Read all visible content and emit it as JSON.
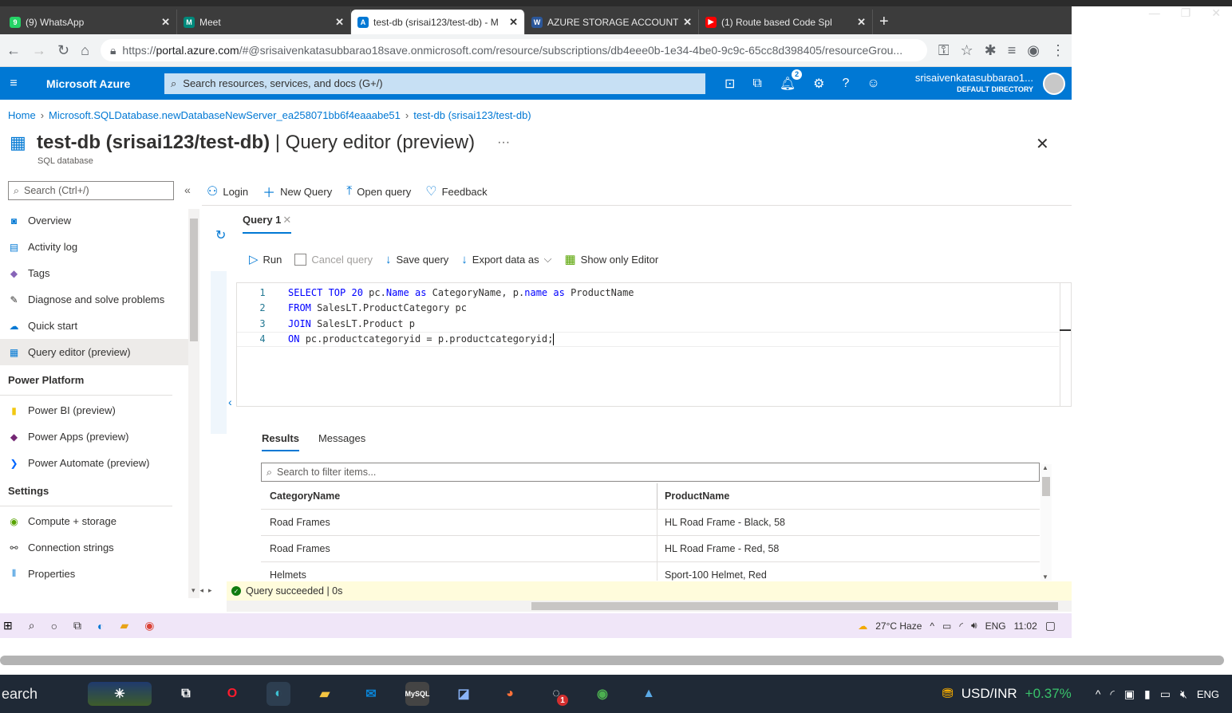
{
  "browser": {
    "tabs": [
      {
        "title": "(9) WhatsApp",
        "color": "#25d366",
        "glyph": "9"
      },
      {
        "title": "Meet",
        "color": "#00897b",
        "glyph": "M"
      },
      {
        "title": "test-db (srisai123/test-db) - M",
        "color": "#0078d4",
        "glyph": "A",
        "active": true
      },
      {
        "title": "AZURE STORAGE ACCOUNTS",
        "color": "#2b579a",
        "glyph": "W"
      },
      {
        "title": "(1) Route based Code Spl",
        "color": "#ff0000",
        "glyph": "▶"
      }
    ],
    "url_prefix": "https://",
    "url_host": "portal.azure.com",
    "url_rest": "/#@srisaivenkatasubbarao18save.onmicrosoft.com/resource/subscriptions/db4eee0b-1e34-4be0-9c9c-65cc8d398405/resourceGrou..."
  },
  "azure": {
    "brand": "Microsoft Azure",
    "search_placeholder": "Search resources, services, and docs (G+/)",
    "notif_count": "2",
    "account_name": "srisaivenkatasubbarao1...",
    "account_dir": "DEFAULT DIRECTORY"
  },
  "breadcrumb": [
    "Home",
    "Microsoft.SQLDatabase.newDatabaseNewServer_ea258071bb6f4eaaabe51",
    "test-db (srisai123/test-db)"
  ],
  "page": {
    "title_bold": "test-db (srisai123/test-db)",
    "title_rest": " | Query editor (preview)",
    "subtitle": "SQL database",
    "more": "···",
    "close": "✕"
  },
  "sidebar": {
    "search_placeholder": "Search (Ctrl+/)",
    "items": [
      {
        "label": "Overview",
        "icon": "sql-icon",
        "color": "#0078d4"
      },
      {
        "label": "Activity log",
        "icon": "log-icon",
        "color": "#0078d4"
      },
      {
        "label": "Tags",
        "icon": "tag-icon",
        "color": "#8764b8"
      },
      {
        "label": "Diagnose and solve problems",
        "icon": "wrench-icon",
        "color": "#323130"
      },
      {
        "label": "Quick start",
        "icon": "cloud-icon",
        "color": "#0078d4"
      },
      {
        "label": "Query editor (preview)",
        "icon": "grid-icon",
        "color": "#0078d4",
        "active": true
      }
    ],
    "section_power": "Power Platform",
    "power_items": [
      {
        "label": "Power BI (preview)",
        "color": "#f2c811"
      },
      {
        "label": "Power Apps (preview)",
        "color": "#742774"
      },
      {
        "label": "Power Automate (preview)",
        "color": "#0066ff"
      }
    ],
    "section_settings": "Settings",
    "settings_items": [
      {
        "label": "Compute + storage",
        "color": "#57a300"
      },
      {
        "label": "Connection strings",
        "color": "#323130"
      },
      {
        "label": "Properties",
        "color": "#0078d4"
      }
    ]
  },
  "toolbar": {
    "login": "Login",
    "new_query": "New Query",
    "open_query": "Open query",
    "feedback": "Feedback"
  },
  "query_tab": "Query 1",
  "query_tools": {
    "run": "Run",
    "cancel": "Cancel query",
    "save": "Save query",
    "export": "Export data as",
    "show_editor": "Show only Editor"
  },
  "code_lines": [
    {
      "n": "1",
      "parts": [
        [
          "kw",
          "SELECT TOP 20 "
        ],
        [
          "",
          "pc."
        ],
        [
          "kw",
          "Name"
        ],
        [
          "kw",
          " as "
        ],
        [
          "",
          "CategoryName, p."
        ],
        [
          "kw",
          "name"
        ],
        [
          "kw",
          " as "
        ],
        [
          "",
          "ProductName"
        ]
      ]
    },
    {
      "n": "2",
      "parts": [
        [
          "kw",
          "FROM "
        ],
        [
          "",
          "SalesLT.ProductCategory pc"
        ]
      ]
    },
    {
      "n": "3",
      "parts": [
        [
          "kw",
          "JOIN "
        ],
        [
          "",
          "SalesLT.Product p"
        ]
      ]
    },
    {
      "n": "4",
      "parts": [
        [
          "kw",
          "ON "
        ],
        [
          "",
          "pc.productcategoryid = p.productcategoryid;"
        ]
      ]
    }
  ],
  "results": {
    "tab_results": "Results",
    "tab_messages": "Messages",
    "search_placeholder": "Search to filter items...",
    "columns": [
      "CategoryName",
      "ProductName"
    ],
    "rows": [
      [
        "Road Frames",
        "HL Road Frame - Black, 58"
      ],
      [
        "Road Frames",
        "HL Road Frame - Red, 58"
      ],
      [
        "Helmets",
        "Sport-100 Helmet, Red"
      ]
    ]
  },
  "status": "Query succeeded | 0s",
  "inner_taskbar": {
    "weather": "27°C  Haze",
    "lang": "ENG",
    "time": "11:02"
  },
  "taskbar": {
    "search": "earch",
    "currency": "USD/INR",
    "change": "+0.37%",
    "lang": "ENG",
    "mail_badge": "1"
  }
}
